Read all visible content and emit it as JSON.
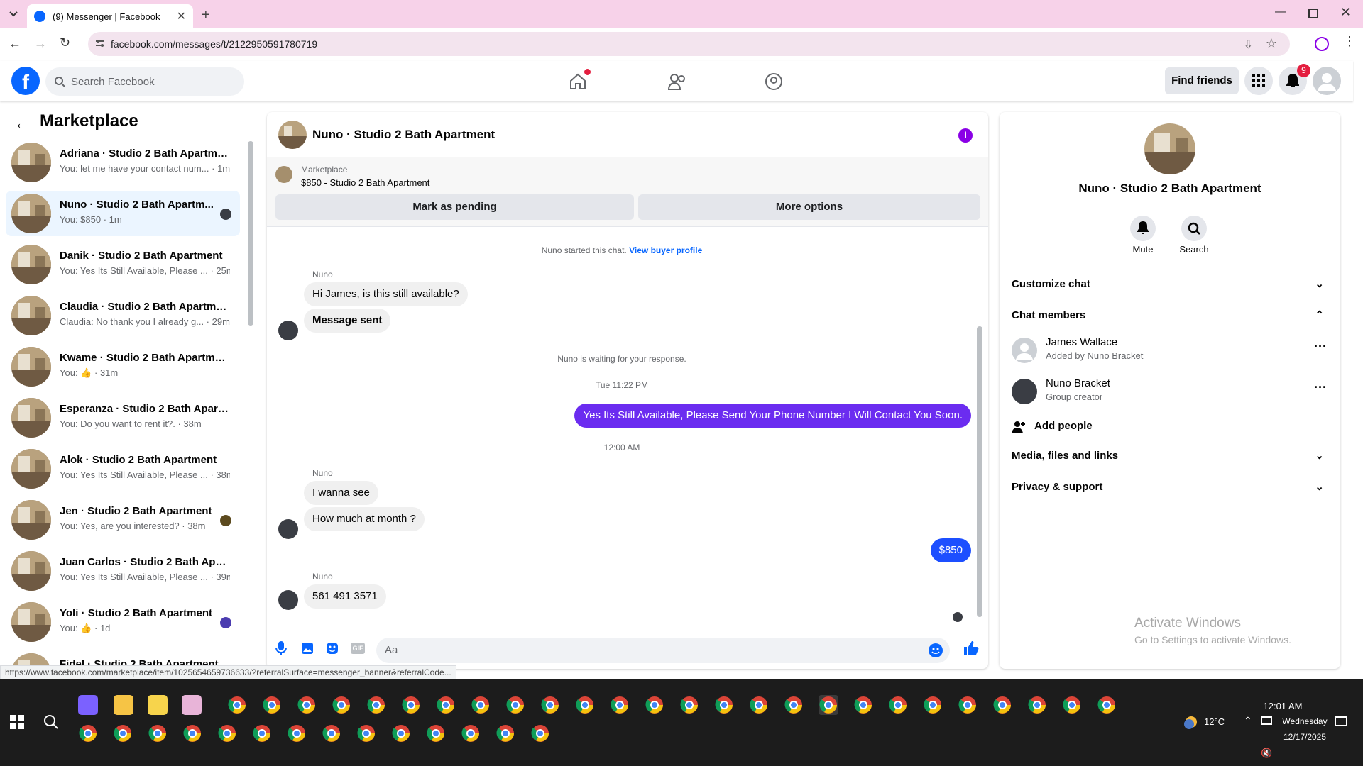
{
  "browser": {
    "tab_title": "(9) Messenger | Facebook",
    "url": "facebook.com/messages/t/2122950591780719",
    "status_url": "https://www.facebook.com/marketplace/item/1025654659736633/?referralSurface=messenger_banner&referralCode..."
  },
  "header": {
    "search_placeholder": "Search Facebook",
    "find_friends": "Find friends",
    "notification_count": "9"
  },
  "sidebar": {
    "title": "Marketplace",
    "conversations": [
      {
        "name": "Adriana · Studio 2 Bath Apartme...",
        "msg": "You: let me have your contact num... · 1m"
      },
      {
        "name": "Nuno · Studio 2 Bath Apartm...",
        "msg": "You: $850 · 1m"
      },
      {
        "name": "Danik · Studio 2 Bath Apartment",
        "msg": "You: Yes Its Still Available, Please ... · 25m"
      },
      {
        "name": "Claudia · Studio 2 Bath Apartment",
        "msg": "Claudia: No thank you I already g... · 29m"
      },
      {
        "name": "Kwame · Studio 2 Bath Apartment",
        "msg": "You:",
        "suffix": "· 31m"
      },
      {
        "name": "Esperanza · Studio 2 Bath Apart...",
        "msg": "You: Do you want to rent it?. · 38m"
      },
      {
        "name": "Alok · Studio 2 Bath Apartment",
        "msg": "You: Yes Its Still Available, Please ... · 38m"
      },
      {
        "name": "Jen · Studio 2 Bath Apartment",
        "msg": "You: Yes, are you interested? · 38m"
      },
      {
        "name": "Juan Carlos · Studio 2 Bath Apar...",
        "msg": "You: Yes Its Still Available, Please ... · 39m"
      },
      {
        "name": "Yoli · Studio 2 Bath Apartment",
        "msg": "You:",
        "suffix": "· 1d"
      },
      {
        "name": "Fidel · Studio 2 Bath Apartment",
        "msg": ""
      }
    ]
  },
  "chat": {
    "title": "Nuno · Studio 2 Bath Apartment",
    "banner_label": "Marketplace",
    "banner_item": "$850 - Studio 2 Bath Apartment",
    "mark_pending": "Mark as pending",
    "more_options": "More options",
    "started": "Nuno started this chat.",
    "view_buyer": "View buyer profile",
    "sender": "Nuno",
    "msg1": "Hi James, is this still available?",
    "msg2": "Message sent",
    "waiting": "Nuno is waiting for your response.",
    "time1": "Tue 11:22 PM",
    "out1": "Yes Its Still Available, Please Send Your Phone Number I Will Contact You Soon.",
    "time2": "12:00 AM",
    "msg3": "I wanna see",
    "msg4": "How much at month ?",
    "out2": "$850",
    "msg5": "561 491 3571",
    "composer_placeholder": "Aa"
  },
  "info": {
    "title": "Nuno · Studio 2 Bath Apartment",
    "mute": "Mute",
    "search": "Search",
    "customize": "Customize chat",
    "members": "Chat members",
    "member1_name": "James Wallace",
    "member1_role": "Added by Nuno Bracket",
    "member2_name": "Nuno Bracket",
    "member2_role": "Group creator",
    "add_people": "Add people",
    "media": "Media, files and links",
    "privacy": "Privacy & support"
  },
  "watermark": {
    "line1": "Activate Windows",
    "line2": "Go to Settings to activate Windows."
  },
  "taskbar": {
    "temp": "12°C",
    "time": "12:01 AM",
    "day": "Wednesday",
    "date": "12/17/2025"
  },
  "colors": {
    "fb_blue": "#0866ff",
    "bubble_out": "#6b2cf0",
    "accent_purple": "#8a00e6"
  }
}
